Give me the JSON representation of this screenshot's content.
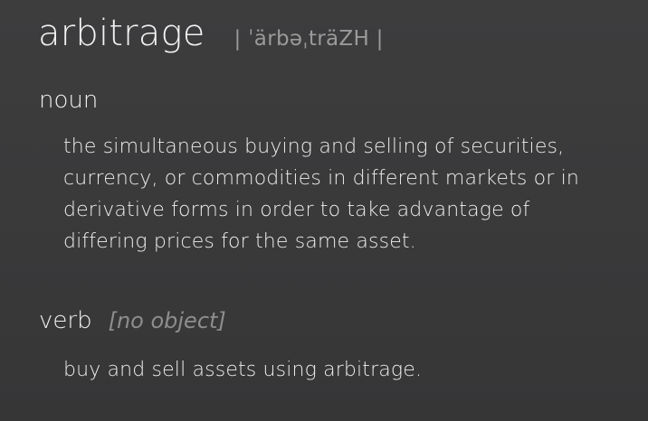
{
  "entry": {
    "headword": "arbitrage",
    "pronunciation": "| ˈärbəˌträZH |"
  },
  "senses": [
    {
      "part_of_speech": "noun",
      "grammar": "",
      "definition_lines": [
        "the simultaneous buying and selling of securities,",
        "currency, or commodities in different markets or in",
        "derivative forms in order to take advantage of",
        "differing prices for the same asset."
      ]
    },
    {
      "part_of_speech": "verb",
      "grammar": "[no object]",
      "definition_lines": [
        "buy and sell assets using arbitrage."
      ]
    }
  ],
  "colors": {
    "background": "#3a3a3b",
    "primary_text": "#efefef",
    "secondary_text": "#9a9a9a"
  }
}
